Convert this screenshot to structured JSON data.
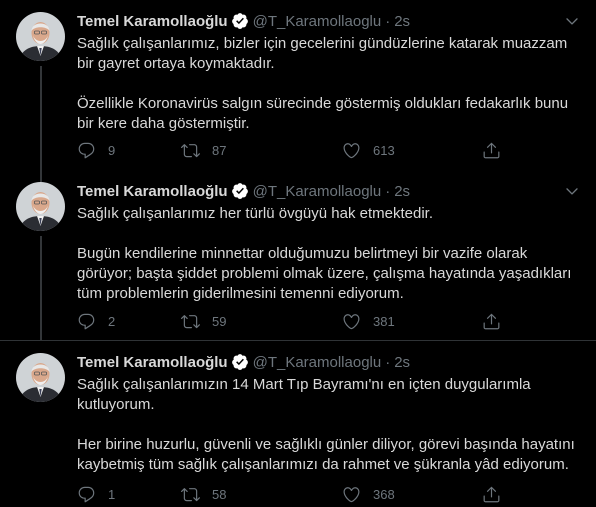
{
  "colors": {
    "background": "#000000",
    "text": "#d9d9d9",
    "muted": "#6e767d",
    "verified": "#ffffff",
    "divider": "#2f3336"
  },
  "tweets": [
    {
      "name": "Temel Karamollaoğlu",
      "handle": "@T_Karamollaoglu",
      "separator": "·",
      "time": "2s",
      "paragraphs": [
        "Sağlık çalışanlarımız, bizler için gecelerini gündüzlerine katarak muazzam bir gayret ortaya koymaktadır.",
        "Özellikle Koronavirüs salgın sürecinde göstermiş oldukları fedakarlık bunu bir kere daha göstermiştir."
      ],
      "replies": "9",
      "retweets": "87",
      "likes": "613"
    },
    {
      "name": "Temel Karamollaoğlu",
      "handle": "@T_Karamollaoglu",
      "separator": "·",
      "time": "2s",
      "paragraphs": [
        "Sağlık çalışanlarımız her türlü övgüyü hak etmektedir.",
        "Bugün kendilerine minnettar olduğumuzu belirtmeyi bir vazife olarak görüyor; başta şiddet problemi olmak üzere, çalışma hayatında yaşadıkları tüm problemlerin giderilmesini temenni ediyorum."
      ],
      "replies": "2",
      "retweets": "59",
      "likes": "381"
    },
    {
      "name": "Temel Karamollaoğlu",
      "handle": "@T_Karamollaoglu",
      "separator": "·",
      "time": "2s",
      "paragraphs": [
        "Sağlık çalışanlarımızın 14 Mart Tıp Bayramı'nı en içten duygularımla kutluyorum.",
        "Her birine huzurlu, güvenli ve sağlıklı günler diliyor, görevi başında hayatını kaybetmiş tüm sağlık çalışanlarımızı da rahmet ve şükranla yâd ediyorum."
      ],
      "replies": "1",
      "retweets": "58",
      "likes": "368"
    }
  ],
  "icons": {
    "verified": "verified-badge-icon",
    "more": "chevron-down-icon",
    "reply": "reply-icon",
    "retweet": "retweet-icon",
    "like": "heart-icon",
    "share": "share-icon"
  }
}
